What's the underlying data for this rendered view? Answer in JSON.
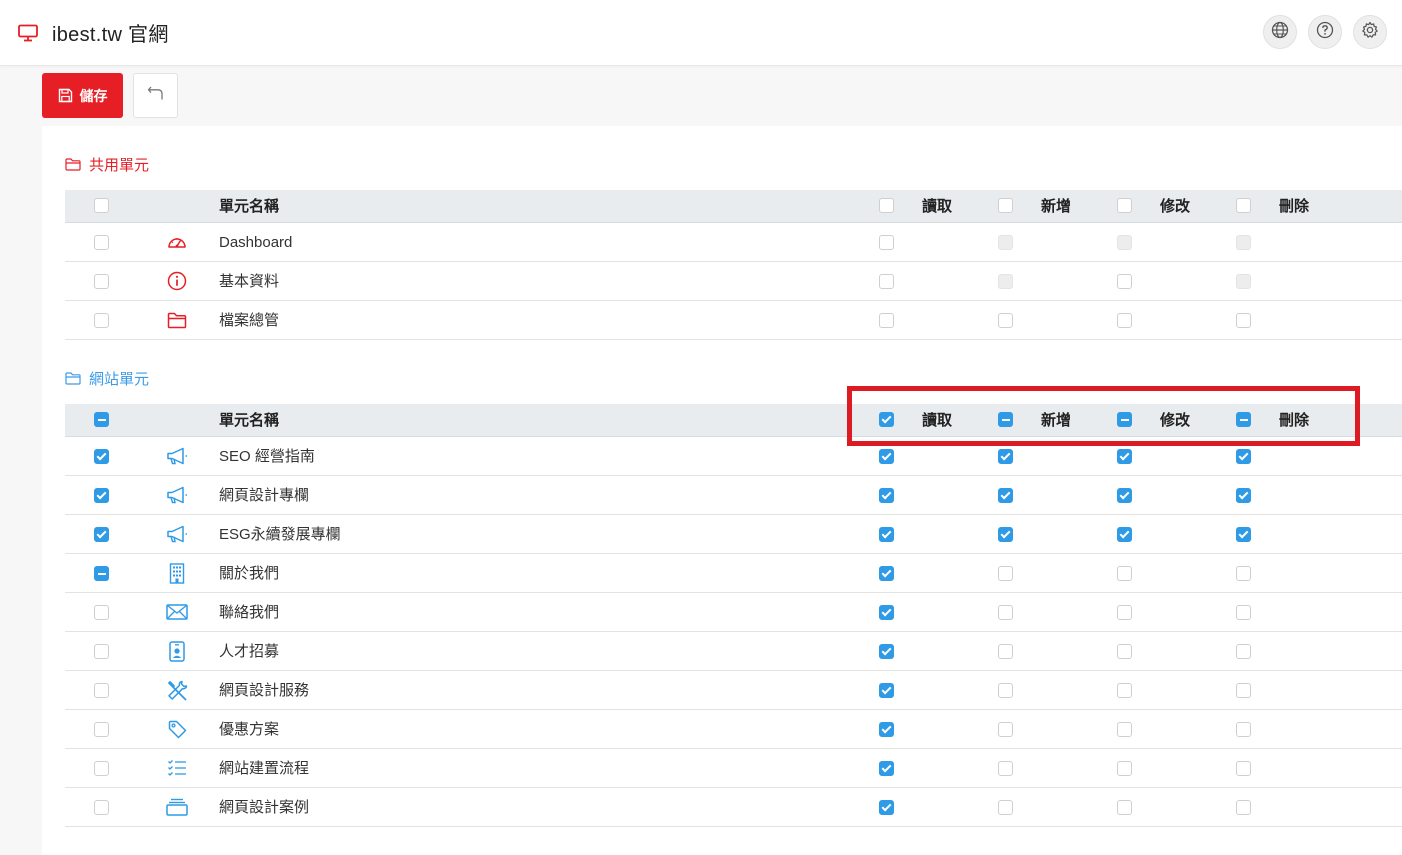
{
  "header": {
    "title": "ibest.tw 官網",
    "brand_icon": "monitor-icon",
    "actions": [
      "globe-icon",
      "help-icon",
      "gear-icon"
    ]
  },
  "toolbar": {
    "save_label": "儲存",
    "back_icon": "undo-icon"
  },
  "colors": {
    "brand_red": "#e51f25",
    "accent_blue": "#2f9ae6",
    "highlight_red": "#dd1b22"
  },
  "columns": {
    "name": "單元名稱",
    "read": "讀取",
    "add": "新增",
    "edit": "修改",
    "delete": "刪除"
  },
  "sections": [
    {
      "title": "共用單元",
      "header_states": {
        "select": "unchecked",
        "read": "unchecked",
        "add": "unchecked",
        "edit": "unchecked",
        "delete": "unchecked"
      },
      "rows": [
        {
          "name": "Dashboard",
          "icon": "dashboard-icon",
          "select": "unchecked",
          "read": "unchecked",
          "add": "disabled",
          "edit": "disabled",
          "delete": "disabled"
        },
        {
          "name": "基本資料",
          "icon": "info-icon",
          "select": "unchecked",
          "read": "unchecked",
          "add": "disabled",
          "edit": "unchecked",
          "delete": "disabled"
        },
        {
          "name": "檔案總管",
          "icon": "folder-icon",
          "select": "unchecked",
          "read": "unchecked",
          "add": "unchecked",
          "edit": "unchecked",
          "delete": "unchecked"
        }
      ]
    },
    {
      "title": "網站單元",
      "header_states": {
        "select": "indeterminate",
        "read": "checked",
        "add": "indeterminate",
        "edit": "indeterminate",
        "delete": "indeterminate"
      },
      "rows": [
        {
          "name": "SEO 經營指南",
          "icon": "megaphone-icon",
          "select": "checked",
          "read": "checked",
          "add": "checked",
          "edit": "checked",
          "delete": "checked"
        },
        {
          "name": "網頁設計專欄",
          "icon": "megaphone-icon",
          "select": "checked",
          "read": "checked",
          "add": "checked",
          "edit": "checked",
          "delete": "checked"
        },
        {
          "name": "ESG永續發展專欄",
          "icon": "megaphone-icon",
          "select": "checked",
          "read": "checked",
          "add": "checked",
          "edit": "checked",
          "delete": "checked"
        },
        {
          "name": "關於我們",
          "icon": "building-icon",
          "select": "indeterminate",
          "read": "checked",
          "add": "unchecked",
          "edit": "unchecked",
          "delete": "unchecked"
        },
        {
          "name": "聯絡我們",
          "icon": "envelope-icon",
          "select": "unchecked",
          "read": "checked",
          "add": "unchecked",
          "edit": "unchecked",
          "delete": "unchecked"
        },
        {
          "name": "人才招募",
          "icon": "person-badge-icon",
          "select": "unchecked",
          "read": "checked",
          "add": "unchecked",
          "edit": "unchecked",
          "delete": "unchecked"
        },
        {
          "name": "網頁設計服務",
          "icon": "tools-icon",
          "select": "unchecked",
          "read": "checked",
          "add": "unchecked",
          "edit": "unchecked",
          "delete": "unchecked"
        },
        {
          "name": "優惠方案",
          "icon": "tag-icon",
          "select": "unchecked",
          "read": "checked",
          "add": "unchecked",
          "edit": "unchecked",
          "delete": "unchecked"
        },
        {
          "name": "網站建置流程",
          "icon": "list-check-icon",
          "select": "unchecked",
          "read": "checked",
          "add": "unchecked",
          "edit": "unchecked",
          "delete": "unchecked"
        },
        {
          "name": "網頁設計案例",
          "icon": "collection-icon",
          "select": "unchecked",
          "read": "checked",
          "add": "unchecked",
          "edit": "unchecked",
          "delete": "unchecked"
        }
      ]
    }
  ]
}
